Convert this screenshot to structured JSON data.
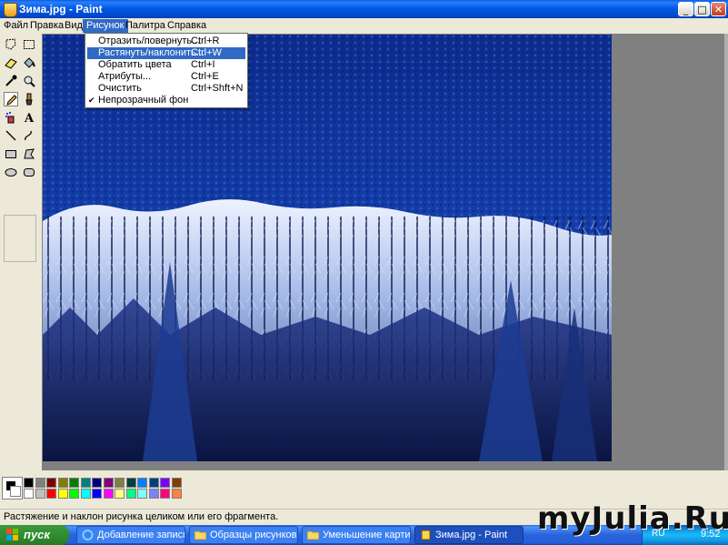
{
  "window": {
    "title": "Зима.jpg - Paint"
  },
  "menubar": {
    "items": [
      "Файл",
      "Правка",
      "Вид",
      "Рисунок",
      "Палитра",
      "Справка"
    ]
  },
  "dropdown": {
    "items": [
      {
        "label": "Отразить/повернуть...",
        "shortcut": "Ctrl+R"
      },
      {
        "label": "Растянуть/наклонить...",
        "shortcut": "Ctrl+W"
      },
      {
        "label": "Обратить цвета",
        "shortcut": "Ctrl+I"
      },
      {
        "label": "Атрибуты...",
        "shortcut": "Ctrl+E"
      },
      {
        "label": "Очистить",
        "shortcut": "Ctrl+Shft+N"
      },
      {
        "label": "Непрозрачный фон",
        "shortcut": "",
        "check": "✔"
      }
    ]
  },
  "tools": [
    "free-select",
    "rect-select",
    "eraser",
    "fill",
    "color-picker",
    "magnifier",
    "pencil",
    "brush",
    "airbrush",
    "text",
    "line",
    "curve",
    "rectangle",
    "polygon",
    "ellipse",
    "rounded-rect"
  ],
  "palette": {
    "row1": [
      "#000000",
      "#808080",
      "#800000",
      "#808000",
      "#008000",
      "#008080",
      "#000080",
      "#800080",
      "#808040",
      "#004040",
      "#0080ff",
      "#004080",
      "#8000ff",
      "#804000"
    ],
    "row2": [
      "#ffffff",
      "#c0c0c0",
      "#ff0000",
      "#ffff00",
      "#00ff00",
      "#00ffff",
      "#0000ff",
      "#ff00ff",
      "#ffff80",
      "#00ff80",
      "#80ffff",
      "#8080ff",
      "#ff0080",
      "#ff8040"
    ]
  },
  "status": {
    "text": "Растяжение и наклон рисунка целиком или его фрагмента."
  },
  "taskbar": {
    "start_label": "пуск",
    "tasks": [
      "Добавление записи ...",
      "Образцы рисунков",
      "Уменьшение картинок",
      "Зима.jpg - Paint"
    ],
    "lang": "RU",
    "clock": "9:52"
  },
  "watermark": "myJulia.Ru"
}
